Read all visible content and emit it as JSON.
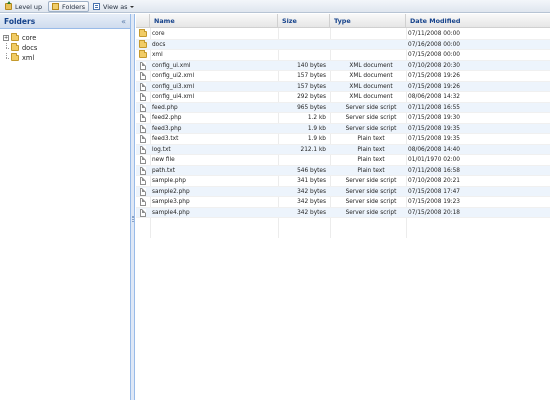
{
  "toolbar": {
    "level_up": "Level up",
    "folders": "Folders",
    "view_as": "View as"
  },
  "left_panel": {
    "title": "Folders",
    "collapse": "«",
    "tree": [
      {
        "label": "core",
        "expandable": true
      },
      {
        "label": "docs",
        "expandable": false
      },
      {
        "label": "xml",
        "expandable": false
      }
    ]
  },
  "grid": {
    "columns": [
      "Name",
      "Size",
      "Type",
      "Date Modified"
    ],
    "rows": [
      {
        "kind": "folder",
        "name": "core",
        "size": "",
        "type": "",
        "date": "07/11/2008 00:00"
      },
      {
        "kind": "folder",
        "name": "docs",
        "size": "",
        "type": "",
        "date": "07/16/2008 00:00"
      },
      {
        "kind": "folder",
        "name": "xml",
        "size": "",
        "type": "",
        "date": "07/15/2008 00:00"
      },
      {
        "kind": "file",
        "name": "config_ui.xml",
        "size": "140 bytes",
        "type": "XML document",
        "date": "07/10/2008 20:30"
      },
      {
        "kind": "file",
        "name": "config_ui2.xml",
        "size": "157 bytes",
        "type": "XML document",
        "date": "07/15/2008 19:26"
      },
      {
        "kind": "file",
        "name": "config_ui3.xml",
        "size": "157 bytes",
        "type": "XML document",
        "date": "07/15/2008 19:26"
      },
      {
        "kind": "file",
        "name": "config_ui4.xml",
        "size": "292 bytes",
        "type": "XML document",
        "date": "08/06/2008 14:32"
      },
      {
        "kind": "file",
        "name": "feed.php",
        "size": "965 bytes",
        "type": "Server side script",
        "date": "07/11/2008 16:55"
      },
      {
        "kind": "file",
        "name": "feed2.php",
        "size": "1.2 kb",
        "type": "Server side script",
        "date": "07/15/2008 19:30"
      },
      {
        "kind": "file",
        "name": "feed3.php",
        "size": "1.9 kb",
        "type": "Server side script",
        "date": "07/15/2008 19:35"
      },
      {
        "kind": "file",
        "name": "feed3.txt",
        "size": "1.9 kb",
        "type": "Plain text",
        "date": "07/15/2008 19:35"
      },
      {
        "kind": "file",
        "name": "log.txt",
        "size": "212.1 kb",
        "type": "Plain text",
        "date": "08/06/2008 14:40"
      },
      {
        "kind": "file",
        "name": "new file",
        "size": "",
        "type": "Plain text",
        "date": "01/01/1970 02:00"
      },
      {
        "kind": "file",
        "name": "path.txt",
        "size": "546 bytes",
        "type": "Plain text",
        "date": "07/11/2008 16:58"
      },
      {
        "kind": "file",
        "name": "sample.php",
        "size": "341 bytes",
        "type": "Server side script",
        "date": "07/10/2008 20:21"
      },
      {
        "kind": "file",
        "name": "sample2.php",
        "size": "342 bytes",
        "type": "Server side script",
        "date": "07/15/2008 17:47"
      },
      {
        "kind": "file",
        "name": "sample3.php",
        "size": "342 bytes",
        "type": "Server side script",
        "date": "07/15/2008 19:23"
      },
      {
        "kind": "file",
        "name": "sample4.php",
        "size": "342 bytes",
        "type": "Server side script",
        "date": "07/15/2008 20:18"
      }
    ]
  }
}
